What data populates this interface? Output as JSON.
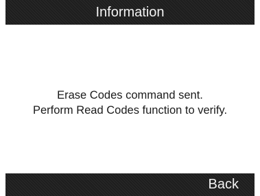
{
  "header": {
    "title": "Information"
  },
  "message": {
    "line1": "Erase Codes command sent.",
    "line2": "Perform Read Codes function to verify."
  },
  "footer": {
    "back_label": "Back"
  },
  "colors": {
    "bar_background": "#1e1e1e",
    "bar_text": "#f2f2f2",
    "content_background": "#ffffff",
    "content_text": "#1a1a1a"
  }
}
